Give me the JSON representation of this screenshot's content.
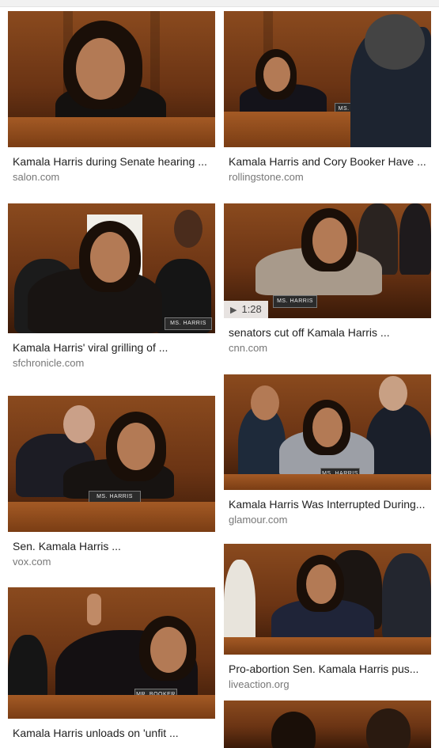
{
  "results": {
    "left": [
      {
        "title": "Kamala Harris during Senate hearing ...",
        "source": "salon.com"
      },
      {
        "title": "Kamala Harris' viral grilling of ...",
        "source": "sfchronicle.com",
        "plate": "MS. HARRIS"
      },
      {
        "title": "Sen. Kamala Harris ...",
        "source": "vox.com",
        "plate": "MS. HARRIS"
      },
      {
        "title": "Kamala Harris unloads on 'unfit ...",
        "source": "",
        "plate": "MR. BOOKER"
      }
    ],
    "right": [
      {
        "title": "Kamala Harris and Cory Booker Have ...",
        "source": "rollingstone.com",
        "plate": "MS. HAR"
      },
      {
        "title": "senators cut off Kamala Harris ...",
        "source": "cnn.com",
        "plate": "MS. HARRIS",
        "video_duration": "1:28"
      },
      {
        "title": "Kamala Harris Was Interrupted During...",
        "source": "glamour.com",
        "plate": "MS. HARRIS"
      },
      {
        "title": "Pro-abortion Sen. Kamala Harris pus...",
        "source": "liveaction.org"
      },
      {
        "title": "",
        "source": ""
      }
    ]
  },
  "icons": {
    "play": "play-icon"
  },
  "colors": {
    "title": "#222222",
    "source": "#777777",
    "wood": "#7a3d14"
  }
}
